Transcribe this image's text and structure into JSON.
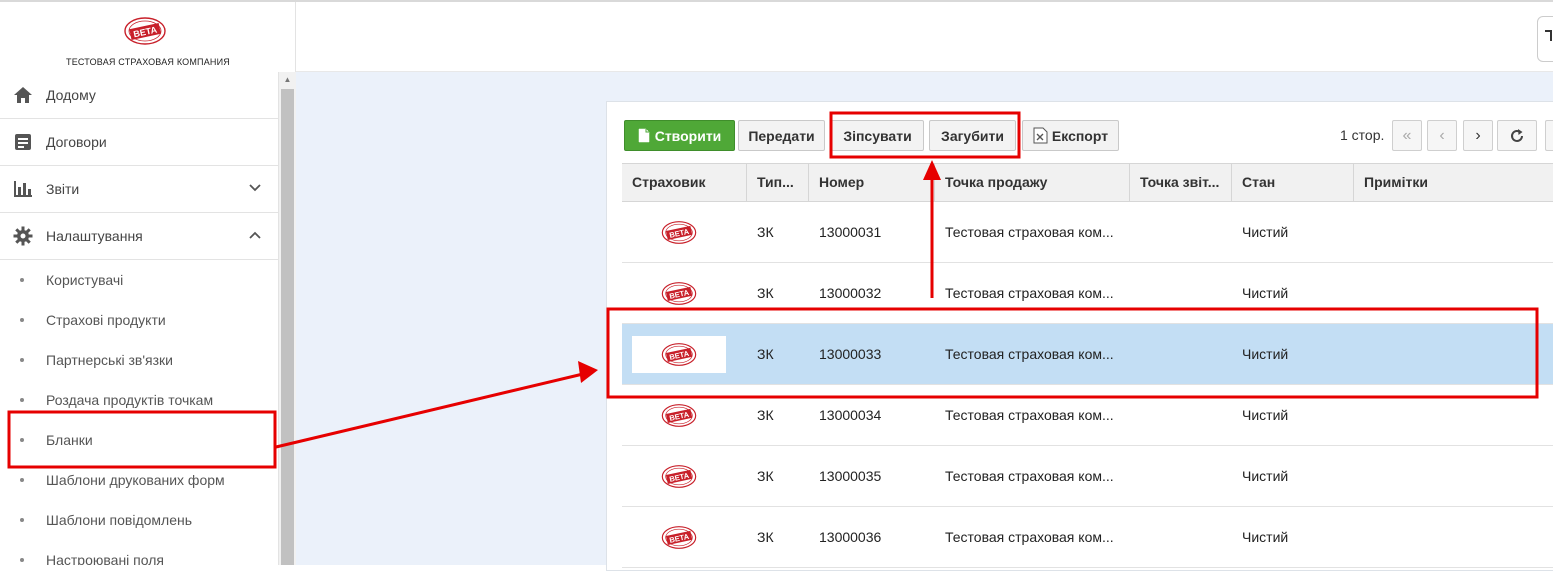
{
  "company": {
    "logo_text": "BETA",
    "name": "ТЕСТОВАЯ СТРАХОВАЯ КОМПАНИЯ"
  },
  "sidebar": {
    "items": [
      {
        "label": "Додому",
        "icon": "home-icon"
      },
      {
        "label": "Договори",
        "icon": "document-icon"
      },
      {
        "label": "Звіти",
        "icon": "bar-chart-icon",
        "chevron": "chevron-down-icon"
      },
      {
        "label": "Налаштування",
        "icon": "gear-icon",
        "chevron": "chevron-up-icon"
      }
    ],
    "subitems": [
      {
        "label": "Користувачі"
      },
      {
        "label": "Страхові продукти"
      },
      {
        "label": "Партнерські зв'язки"
      },
      {
        "label": "Роздача продуктів точкам"
      },
      {
        "label": "Бланки"
      },
      {
        "label": "Шаблони друкованих форм"
      },
      {
        "label": "Шаблони повідомлень"
      },
      {
        "label": "Настроювані поля"
      }
    ]
  },
  "toolbar": {
    "create_label": "Створити",
    "transfer_label": "Передати",
    "spoil_label": "Зіпсувати",
    "lose_label": "Загубити",
    "export_label": "Експорт",
    "page_label": "1 стор."
  },
  "table": {
    "columns": [
      "Страховик",
      "Тип...",
      "Номер",
      "Точка продажу",
      "Точка звіт...",
      "Стан",
      "Примітки"
    ],
    "rows": [
      {
        "type": "ЗК",
        "number": "13000031",
        "sale_point": "Тестовая страховая ком...",
        "report_point": "",
        "state": "Чистий",
        "notes": ""
      },
      {
        "type": "ЗК",
        "number": "13000032",
        "sale_point": "Тестовая страховая ком...",
        "report_point": "",
        "state": "Чистий",
        "notes": ""
      },
      {
        "type": "ЗК",
        "number": "13000033",
        "sale_point": "Тестовая страховая ком...",
        "report_point": "",
        "state": "Чистий",
        "notes": ""
      },
      {
        "type": "ЗК",
        "number": "13000034",
        "sale_point": "Тестовая страховая ком...",
        "report_point": "",
        "state": "Чистий",
        "notes": ""
      },
      {
        "type": "ЗК",
        "number": "13000035",
        "sale_point": "Тестовая страховая ком...",
        "report_point": "",
        "state": "Чистий",
        "notes": ""
      },
      {
        "type": "ЗК",
        "number": "13000036",
        "sale_point": "Тестовая страховая ком...",
        "report_point": "",
        "state": "Чистий",
        "notes": ""
      }
    ]
  },
  "colors": {
    "create_button": "#4fa837",
    "selected_row": "#c3def4",
    "annotation": "#e60000",
    "main_bg": "#ebf1fa"
  }
}
